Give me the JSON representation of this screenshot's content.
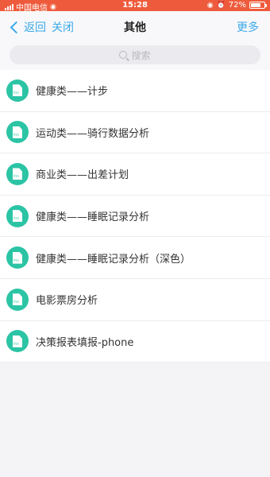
{
  "status_bar": {
    "carrier": "中国电信",
    "time": "15:28",
    "battery": "72%",
    "battery_level": 0.72,
    "bg_color": "#ee5b3c"
  },
  "nav": {
    "back_label": "返回",
    "close_label": "关闭",
    "title": "其他",
    "more_label": "更多",
    "accent_color": "#3aa8e8"
  },
  "search": {
    "placeholder": "搜索"
  },
  "items": [
    {
      "label": "健康类——计步",
      "icon": "frm-file-icon"
    },
    {
      "label": "运动类——骑行数据分析",
      "icon": "frm-file-icon"
    },
    {
      "label": "商业类——出差计划",
      "icon": "frm-file-icon"
    },
    {
      "label": "健康类——睡眠记录分析",
      "icon": "frm-file-icon"
    },
    {
      "label": "健康类——睡眠记录分析（深色）",
      "icon": "frm-file-icon"
    },
    {
      "label": "电影票房分析",
      "icon": "frm-file-icon"
    },
    {
      "label": "决策报表填报-phone",
      "icon": "frm-file-icon"
    }
  ],
  "icon_badge_text": "frm",
  "icon_color": "#2bc4a5"
}
